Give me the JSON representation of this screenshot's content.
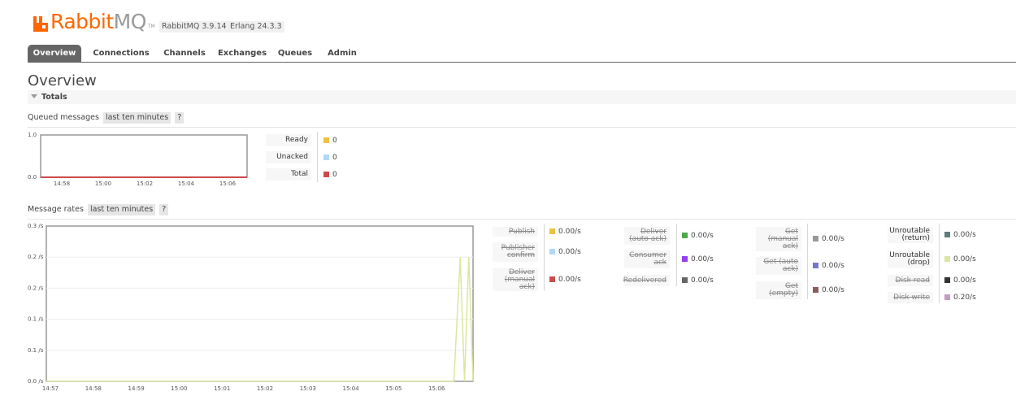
{
  "header": {
    "logo_main": "Rabbit",
    "logo_mq": "MQ",
    "logo_tm": "TM",
    "version_rabbit": "RabbitMQ 3.9.14",
    "version_erlang": "Erlang 24.3.3"
  },
  "tabs": [
    {
      "label": "Overview",
      "active": true
    },
    {
      "label": "Connections",
      "active": false
    },
    {
      "label": "Channels",
      "active": false
    },
    {
      "label": "Exchanges",
      "active": false
    },
    {
      "label": "Queues",
      "active": false
    },
    {
      "label": "Admin",
      "active": false
    }
  ],
  "page_title": "Overview",
  "section_title": "Totals",
  "queued": {
    "label": "Queued messages",
    "range": "last ten minutes",
    "help": "?",
    "legend": [
      {
        "label": "Ready",
        "value": "0",
        "color": "#edc240"
      },
      {
        "label": "Unacked",
        "value": "0",
        "color": "#afd8f8"
      },
      {
        "label": "Total",
        "value": "0",
        "color": "#cb4b4b"
      }
    ]
  },
  "rates": {
    "label": "Message rates",
    "range": "last ten minutes",
    "help": "?",
    "groups": [
      [
        {
          "label": "Publish",
          "value": "0.00/s",
          "color": "#edc240",
          "strike": true
        },
        {
          "label": "Publisher confirm",
          "value": "0.00/s",
          "color": "#afd8f8",
          "strike": true
        },
        {
          "label": "Deliver (manual ack)",
          "value": "0.00/s",
          "color": "#cb4b4b",
          "strike": true
        }
      ],
      [
        {
          "label": "Deliver (auto ack)",
          "value": "0.00/s",
          "color": "#4da74d",
          "strike": true
        },
        {
          "label": "Consumer ack",
          "value": "0.00/s",
          "color": "#9440ed",
          "strike": true
        },
        {
          "label": "Redelivered",
          "value": "0.00/s",
          "color": "#666666",
          "strike": true
        }
      ],
      [
        {
          "label": "Get (manual ack)",
          "value": "0.00/s",
          "color": "#999999",
          "strike": true
        },
        {
          "label": "Get (auto ack)",
          "value": "0.00/s",
          "color": "#7777cc",
          "strike": true
        },
        {
          "label": "Get (empty)",
          "value": "0.00/s",
          "color": "#8c5b5b",
          "strike": true
        }
      ],
      [
        {
          "label": "Unroutable (return)",
          "value": "0.00/s",
          "color": "#607b7b",
          "strike": false
        },
        {
          "label": "Unroutable (drop)",
          "value": "0.00/s",
          "color": "#dde5a0",
          "strike": false
        },
        {
          "label": "Disk read",
          "value": "0.00/s",
          "color": "#333333",
          "strike": true
        },
        {
          "label": "Disk write",
          "value": "0.20/s",
          "color": "#c49cc4",
          "strike": true
        }
      ]
    ]
  },
  "chart_data": [
    {
      "type": "line",
      "title": "",
      "x": [
        "14:58",
        "15:00",
        "15:02",
        "15:04",
        "15:06"
      ],
      "y_ticks": [
        "0.0",
        "1.0"
      ],
      "ylim": [
        0,
        1
      ],
      "series": [
        {
          "name": "Total",
          "color": "#cb4b4b",
          "values": [
            0,
            0,
            0,
            0,
            0
          ]
        }
      ]
    },
    {
      "type": "line",
      "title": "",
      "x": [
        "14:57",
        "14:58",
        "14:59",
        "15:00",
        "15:01",
        "15:02",
        "15:03",
        "15:04",
        "15:05",
        "15:06"
      ],
      "y_ticks": [
        "0.0 /s",
        "0.1 /s",
        "0.1 /s",
        "0.2 /s",
        "0.2 /s",
        "0.3 /s"
      ],
      "ylim": [
        0,
        0.25
      ],
      "series": [
        {
          "name": "Disk write",
          "color": "#dde5a0",
          "points": [
            [
              0,
              0
            ],
            [
              0.955,
              0
            ],
            [
              0.97,
              0.2
            ],
            [
              0.98,
              0
            ],
            [
              0.99,
              0.2
            ],
            [
              1.0,
              0
            ]
          ]
        }
      ]
    }
  ]
}
